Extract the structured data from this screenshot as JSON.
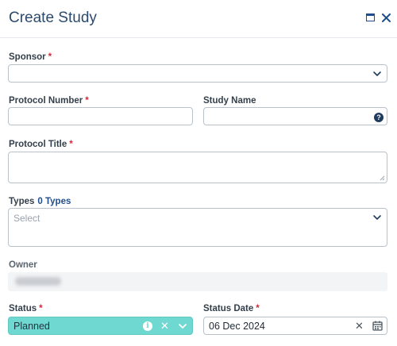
{
  "dialog": {
    "title": "Create Study",
    "icons": {
      "maximize": "maximize-icon",
      "close": "close-icon"
    }
  },
  "form": {
    "sponsor": {
      "label": "Sponsor",
      "required_mark": "*",
      "value": ""
    },
    "protocol_number": {
      "label": "Protocol Number",
      "required_mark": "*",
      "value": ""
    },
    "study_name": {
      "label": "Study Name",
      "value": "",
      "help_icon": "?"
    },
    "protocol_title": {
      "label": "Protocol Title",
      "required_mark": "*",
      "value": ""
    },
    "types": {
      "label": "Types",
      "count_text": "0 Types",
      "placeholder": "Select"
    },
    "owner": {
      "label": "Owner"
    },
    "status": {
      "label": "Status",
      "required_mark": "*",
      "value": "Planned",
      "info_glyph": "i",
      "clear_glyph": "✕"
    },
    "status_date": {
      "label": "Status Date",
      "required_mark": "*",
      "value": "06 Dec 2024",
      "clear_glyph": "✕"
    }
  },
  "colors": {
    "title": "#2c4a6b",
    "accent": "#1f4e8c",
    "required": "#d7263d",
    "status_bg": "#6fd8d0"
  }
}
